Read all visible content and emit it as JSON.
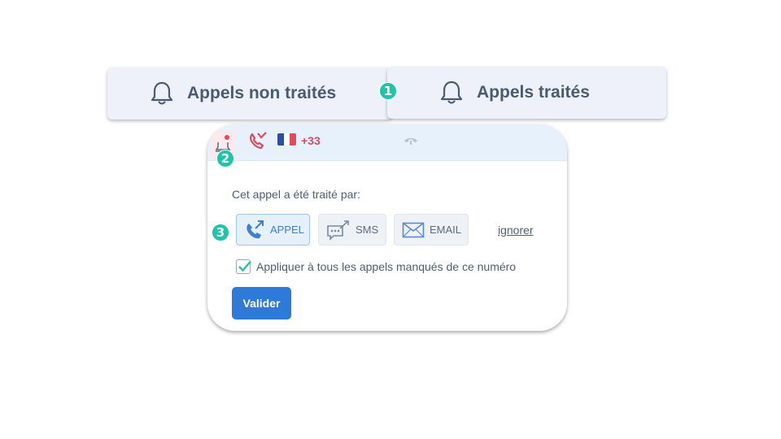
{
  "tabs": {
    "untreated": {
      "label": "Appels non traités",
      "icon": "bell-icon"
    },
    "treated": {
      "label": "Appels traités",
      "icon": "bell-icon"
    }
  },
  "badges": {
    "one": "1",
    "two": "2",
    "three": "3"
  },
  "call": {
    "type_icon": "missed-call-icon",
    "country_flag": "france-flag",
    "prefix": "+33",
    "hangup_icon": "hangup-phone-icon"
  },
  "form": {
    "prompt": "Cet appel a été traité par:",
    "options": [
      {
        "label": "APPEL",
        "icon": "phone-outgoing-icon",
        "selected": true
      },
      {
        "label": "SMS",
        "icon": "chat-outgoing-icon",
        "selected": false
      },
      {
        "label": "EMAIL",
        "icon": "envelope-icon",
        "selected": false
      }
    ],
    "ignore_label": "ignorer",
    "apply_all_label": "Appliquer à tous les appels manqués de ce numéro",
    "apply_all_checked": true,
    "submit_label": "Valider"
  },
  "colors": {
    "accent": "#2e7ad8",
    "badge": "#1dc6a8",
    "missed": "#e04a5b",
    "tab_bg": "#eef1f9"
  }
}
